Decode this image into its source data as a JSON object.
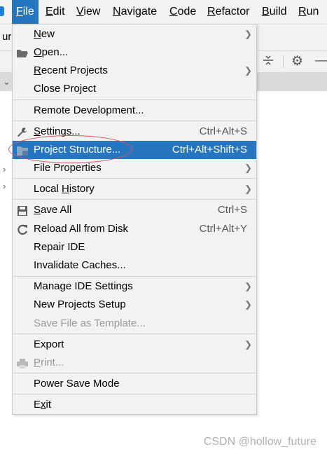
{
  "menubar": {
    "items": [
      {
        "label": "File",
        "mnemonic": "F",
        "rest": "ile"
      },
      {
        "label": "Edit",
        "mnemonic": "E",
        "rest": "dit"
      },
      {
        "label": "View",
        "mnemonic": "V",
        "rest": "iew"
      },
      {
        "label": "Navigate",
        "mnemonic": "N",
        "rest": "avigate"
      },
      {
        "label": "Code",
        "mnemonic": "C",
        "rest": "ode"
      },
      {
        "label": "Refactor",
        "mnemonic": "R",
        "rest": "efactor"
      },
      {
        "label": "Build",
        "mnemonic": "B",
        "rest": "uild"
      },
      {
        "label": "Run",
        "mnemonic": "R",
        "rest": "un"
      }
    ]
  },
  "background": {
    "partial_text": "ur"
  },
  "file_menu": {
    "items": [
      {
        "name": "new",
        "label": "New",
        "shortcut": "",
        "submenu": true
      },
      {
        "name": "open",
        "label": "Open...",
        "shortcut": "",
        "submenu": false
      },
      {
        "name": "recent-projects",
        "label": "Recent Projects",
        "shortcut": "",
        "submenu": true
      },
      {
        "name": "close-project",
        "label": "Close Project",
        "shortcut": "",
        "submenu": false
      },
      {
        "name": "remote-development",
        "label": "Remote Development...",
        "shortcut": "",
        "submenu": false
      },
      {
        "name": "settings",
        "label": "Settings...",
        "shortcut": "Ctrl+Alt+S",
        "submenu": false
      },
      {
        "name": "project-structure",
        "label": "Project Structure...",
        "shortcut": "Ctrl+Alt+Shift+S",
        "submenu": false
      },
      {
        "name": "file-properties",
        "label": "File Properties",
        "shortcut": "",
        "submenu": true
      },
      {
        "name": "local-history",
        "label": "Local History",
        "shortcut": "",
        "submenu": true
      },
      {
        "name": "save-all",
        "label": "Save All",
        "shortcut": "Ctrl+S",
        "submenu": false
      },
      {
        "name": "reload-all",
        "label": "Reload All from Disk",
        "shortcut": "Ctrl+Alt+Y",
        "submenu": false
      },
      {
        "name": "repair-ide",
        "label": "Repair IDE",
        "shortcut": "",
        "submenu": false
      },
      {
        "name": "invalidate-caches",
        "label": "Invalidate Caches...",
        "shortcut": "",
        "submenu": false
      },
      {
        "name": "manage-ide-settings",
        "label": "Manage IDE Settings",
        "shortcut": "",
        "submenu": true
      },
      {
        "name": "new-projects-setup",
        "label": "New Projects Setup",
        "shortcut": "",
        "submenu": true
      },
      {
        "name": "save-file-as-template",
        "label": "Save File as Template...",
        "shortcut": "",
        "submenu": false
      },
      {
        "name": "export",
        "label": "Export",
        "shortcut": "",
        "submenu": true
      },
      {
        "name": "print",
        "label": "Print...",
        "shortcut": "",
        "submenu": false
      },
      {
        "name": "power-save-mode",
        "label": "Power Save Mode",
        "shortcut": "",
        "submenu": false
      },
      {
        "name": "exit",
        "label": "Exit",
        "shortcut": "",
        "submenu": false
      }
    ],
    "selected_item": "Project Structure...",
    "disabled_items": [
      "Save File as Template...",
      "Print..."
    ]
  },
  "colors": {
    "selection": "#2675bf",
    "annotation_circle": "#e0505a",
    "menu_bg": "#f2f2f2"
  },
  "watermark": "CSDN @hollow_future"
}
